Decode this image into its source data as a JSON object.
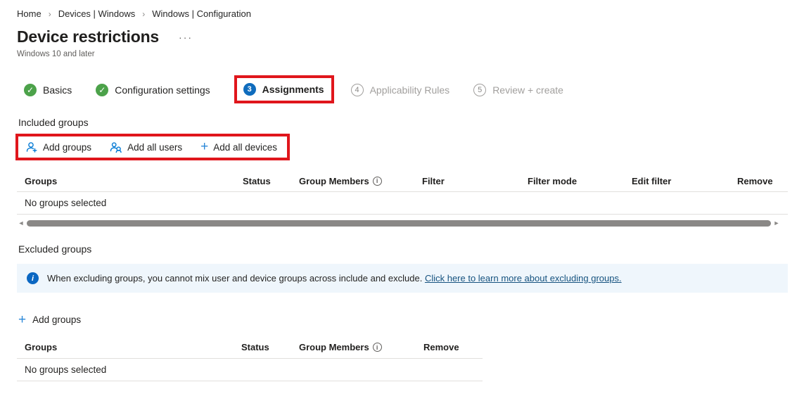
{
  "breadcrumb": {
    "separator": "›",
    "items": [
      {
        "label": "Home"
      },
      {
        "label": "Devices | Windows"
      },
      {
        "label": "Windows | Configuration"
      }
    ]
  },
  "header": {
    "title": "Device restrictions",
    "ellipsis": "···",
    "subtitle": "Windows 10 and later"
  },
  "wizard": {
    "steps": [
      {
        "label": "Basics",
        "state": "complete",
        "glyph": "✓"
      },
      {
        "label": "Configuration settings",
        "state": "complete",
        "glyph": "✓"
      },
      {
        "label": "Assignments",
        "state": "active",
        "number": "3"
      },
      {
        "label": "Applicability Rules",
        "state": "pending",
        "number": "4"
      },
      {
        "label": "Review + create",
        "state": "pending",
        "number": "5"
      }
    ]
  },
  "included": {
    "section_label": "Included groups",
    "toolbar": {
      "add_groups": "Add groups",
      "add_all_users": "Add all users",
      "add_all_devices": "Add all devices",
      "icons": [
        "person-add-icon",
        "people-icon",
        "plus-icon"
      ]
    },
    "table": {
      "columns": {
        "groups": "Groups",
        "status": "Status",
        "group_members": "Group Members",
        "group_members_info": "i",
        "filter": "Filter",
        "filter_mode": "Filter mode",
        "edit_filter": "Edit filter",
        "remove": "Remove"
      },
      "empty_text": "No groups selected"
    }
  },
  "scrollbar": {
    "left_arrow": "◄",
    "right_arrow": "►"
  },
  "excluded": {
    "section_label": "Excluded groups",
    "info_banner": {
      "icon_glyph": "i",
      "text": "When excluding groups, you cannot mix user and device groups across include and exclude.",
      "link": "Click here to learn more about excluding groups."
    },
    "add_groups_label": "Add groups",
    "table": {
      "columns": {
        "groups": "Groups",
        "status": "Status",
        "group_members": "Group Members",
        "group_members_info": "i",
        "remove": "Remove"
      },
      "empty_text": "No groups selected"
    }
  },
  "colors": {
    "annotation_red": "#e0161c",
    "step_complete_green": "#4ca24a",
    "step_active_blue": "#0f6cbd",
    "toolbar_icon_blue": "#0078d4",
    "banner_bg": "#eff6fc",
    "banner_link": "#15527f",
    "scrollbar_thumb": "#8a8886"
  }
}
